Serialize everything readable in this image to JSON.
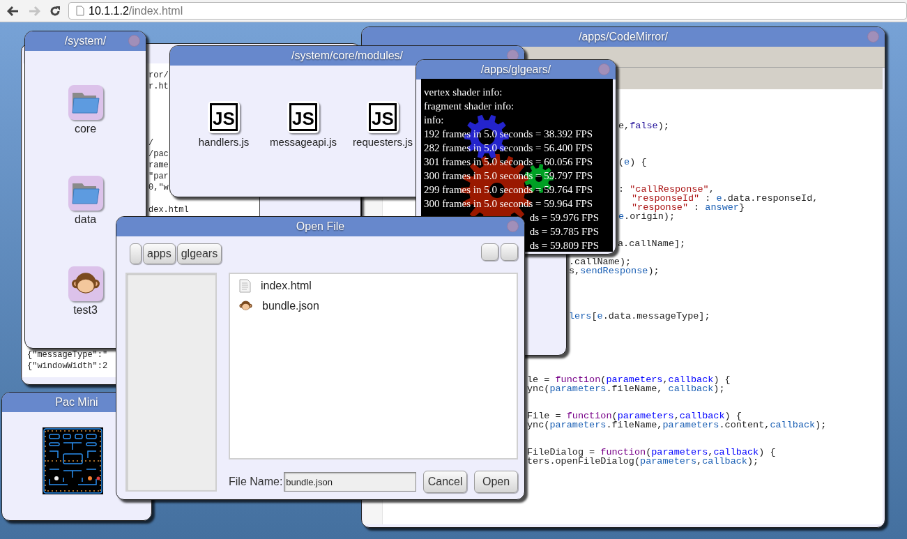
{
  "browser": {
    "back_enabled": true,
    "forward_enabled": false,
    "url_host": "10.1.1.2",
    "url_path": "/index.html"
  },
  "log_window": {
    "lines": [
      "ror/",
      "r.ht",
      "/",
      "/pac",
      "rame",
      "\"par",
      "0,\"w",
      "dex.html",
      "{\"messageType\":\"",
      "{\"windowWidth\":2"
    ]
  },
  "system_window": {
    "title": "/system/",
    "items": [
      {
        "label": "core",
        "kind": "folder"
      },
      {
        "label": "data",
        "kind": "folder"
      },
      {
        "label": "test3",
        "kind": "app"
      }
    ]
  },
  "codemirror_window": {
    "title": "/apps/CodeMirror/",
    "code_lines": [
      {
        "segments": [
          {
            "text": "e,",
            "kind": "plain"
          },
          {
            "text": "false",
            "kind": "atom"
          },
          {
            "text": ");",
            "kind": "plain"
          }
        ]
      },
      {
        "segments": [
          {
            "text": "(",
            "kind": "plain"
          },
          {
            "text": "e",
            "kind": "variable"
          },
          {
            "text": ") {",
            "kind": "plain"
          }
        ]
      },
      {
        "segments": [
          {
            "text": ": ",
            "kind": "plain"
          },
          {
            "text": "\"callResponse\"",
            "kind": "string"
          },
          {
            "text": ",",
            "kind": "plain"
          }
        ]
      },
      {
        "segments": [
          {
            "text": "\"responseId\"",
            "kind": "string"
          },
          {
            "text": " : ",
            "kind": "plain"
          },
          {
            "text": "e",
            "kind": "variable"
          },
          {
            "text": ".data.responseId,",
            "kind": "plain"
          }
        ]
      },
      {
        "segments": [
          {
            "text": "\"response\"",
            "kind": "string"
          },
          {
            "text": " : ",
            "kind": "plain"
          },
          {
            "text": "answer",
            "kind": "variable"
          },
          {
            "text": "}",
            "kind": "plain"
          }
        ]
      },
      {
        "segments": [
          {
            "text": "e",
            "kind": "variable"
          },
          {
            "text": ".origin);",
            "kind": "plain"
          }
        ]
      },
      {
        "segments": [
          {
            "text": "a.callName];",
            "kind": "plain"
          }
        ]
      },
      {
        "segments": [
          {
            "text": ".callName);",
            "kind": "plain"
          }
        ]
      },
      {
        "segments": [
          {
            "text": "s,",
            "kind": "plain"
          },
          {
            "text": "sendResponse",
            "kind": "variable"
          },
          {
            "text": ");",
            "kind": "plain"
          }
        ]
      },
      {
        "segments": [
          {
            "text": "lers",
            "kind": "variable"
          },
          {
            "text": "[",
            "kind": "plain"
          },
          {
            "text": "e",
            "kind": "variable"
          },
          {
            "text": ".data.messageType];",
            "kind": "plain"
          }
        ]
      },
      {
        "segments": [
          {
            "text": "le = ",
            "kind": "plain"
          },
          {
            "text": "function",
            "kind": "keyword"
          },
          {
            "text": "(",
            "kind": "plain"
          },
          {
            "text": "parameters",
            "kind": "def"
          },
          {
            "text": ",",
            "kind": "plain"
          },
          {
            "text": "callback",
            "kind": "def"
          },
          {
            "text": ") {",
            "kind": "plain"
          }
        ]
      },
      {
        "segments": [
          {
            "text": "ync(",
            "kind": "plain"
          },
          {
            "text": "parameters",
            "kind": "variable"
          },
          {
            "text": ".fileName, ",
            "kind": "plain"
          },
          {
            "text": "callback",
            "kind": "variable"
          },
          {
            "text": ");",
            "kind": "plain"
          }
        ]
      },
      {
        "segments": [
          {
            "text": "File = ",
            "kind": "plain"
          },
          {
            "text": "function",
            "kind": "keyword"
          },
          {
            "text": "(",
            "kind": "plain"
          },
          {
            "text": "parameters",
            "kind": "def"
          },
          {
            "text": ",",
            "kind": "plain"
          },
          {
            "text": "callback",
            "kind": "def"
          },
          {
            "text": ") {",
            "kind": "plain"
          }
        ]
      },
      {
        "segments": [
          {
            "text": "ync(",
            "kind": "plain"
          },
          {
            "text": "parameters",
            "kind": "variable"
          },
          {
            "text": ".fileName,",
            "kind": "plain"
          },
          {
            "text": "parameters",
            "kind": "variable"
          },
          {
            "text": ".content,",
            "kind": "plain"
          },
          {
            "text": "callback",
            "kind": "variable"
          },
          {
            "text": ");",
            "kind": "plain"
          }
        ]
      },
      {
        "segments": [
          {
            "text": "FileDialog = ",
            "kind": "plain"
          },
          {
            "text": "function",
            "kind": "keyword"
          },
          {
            "text": "(",
            "kind": "plain"
          },
          {
            "text": "parameters",
            "kind": "def"
          },
          {
            "text": ",",
            "kind": "plain"
          },
          {
            "text": "callback",
            "kind": "def"
          },
          {
            "text": ") {",
            "kind": "plain"
          }
        ]
      },
      {
        "segments": [
          {
            "text": "ters.openFileDialog(",
            "kind": "plain"
          },
          {
            "text": "parameters",
            "kind": "variable"
          },
          {
            "text": ",",
            "kind": "plain"
          },
          {
            "text": "callback",
            "kind": "variable"
          },
          {
            "text": ");",
            "kind": "plain"
          }
        ]
      }
    ]
  },
  "modules_window": {
    "title": "/system/core/modules/",
    "files": [
      {
        "label": "handlers.js",
        "badge": "JS"
      },
      {
        "label": "messageapi.js",
        "badge": "JS"
      },
      {
        "label": "requesters.js",
        "badge": "JS"
      }
    ]
  },
  "glgears_window": {
    "title": "/apps/glgears/",
    "log_lines": [
      {
        "text": "vertex shader info:",
        "kind": "full"
      },
      {
        "text": "fragment shader info:",
        "kind": "full"
      },
      {
        "text": "info:",
        "kind": "full"
      },
      {
        "text": "192 frames in 5.0 seconds = 38.392 FPS",
        "kind": "full"
      },
      {
        "text": "282 frames in 5.0 seconds = 56.400 FPS",
        "kind": "full"
      },
      {
        "text": "301 frames in 5.0 seconds = 60.056 FPS",
        "kind": "full"
      },
      {
        "text": "300 frames in 5.0 seconds = 59.797 FPS",
        "kind": "full"
      },
      {
        "text": "299 frames in 5.0 seconds = 59.764 FPS",
        "kind": "full"
      },
      {
        "text": "300 frames in 5.0 seconds = 59.964 FPS",
        "kind": "full"
      },
      {
        "text": "ds = 59.976 FPS",
        "kind": "tail"
      },
      {
        "text": "ds = 59.785 FPS",
        "kind": "tail"
      },
      {
        "text": "ds = 59.809 FPS",
        "kind": "tail"
      }
    ]
  },
  "pac_window": {
    "title": "Pac Mini"
  },
  "open_file_dialog": {
    "title": "Open File",
    "path": [
      "apps",
      "glgears"
    ],
    "files": [
      {
        "name": "index.html",
        "kind": "document"
      },
      {
        "name": "bundle.json",
        "kind": "app"
      }
    ],
    "file_name_label": "File Name:",
    "file_name": "bundle.json",
    "buttons": [
      "Cancel",
      "Open"
    ]
  }
}
